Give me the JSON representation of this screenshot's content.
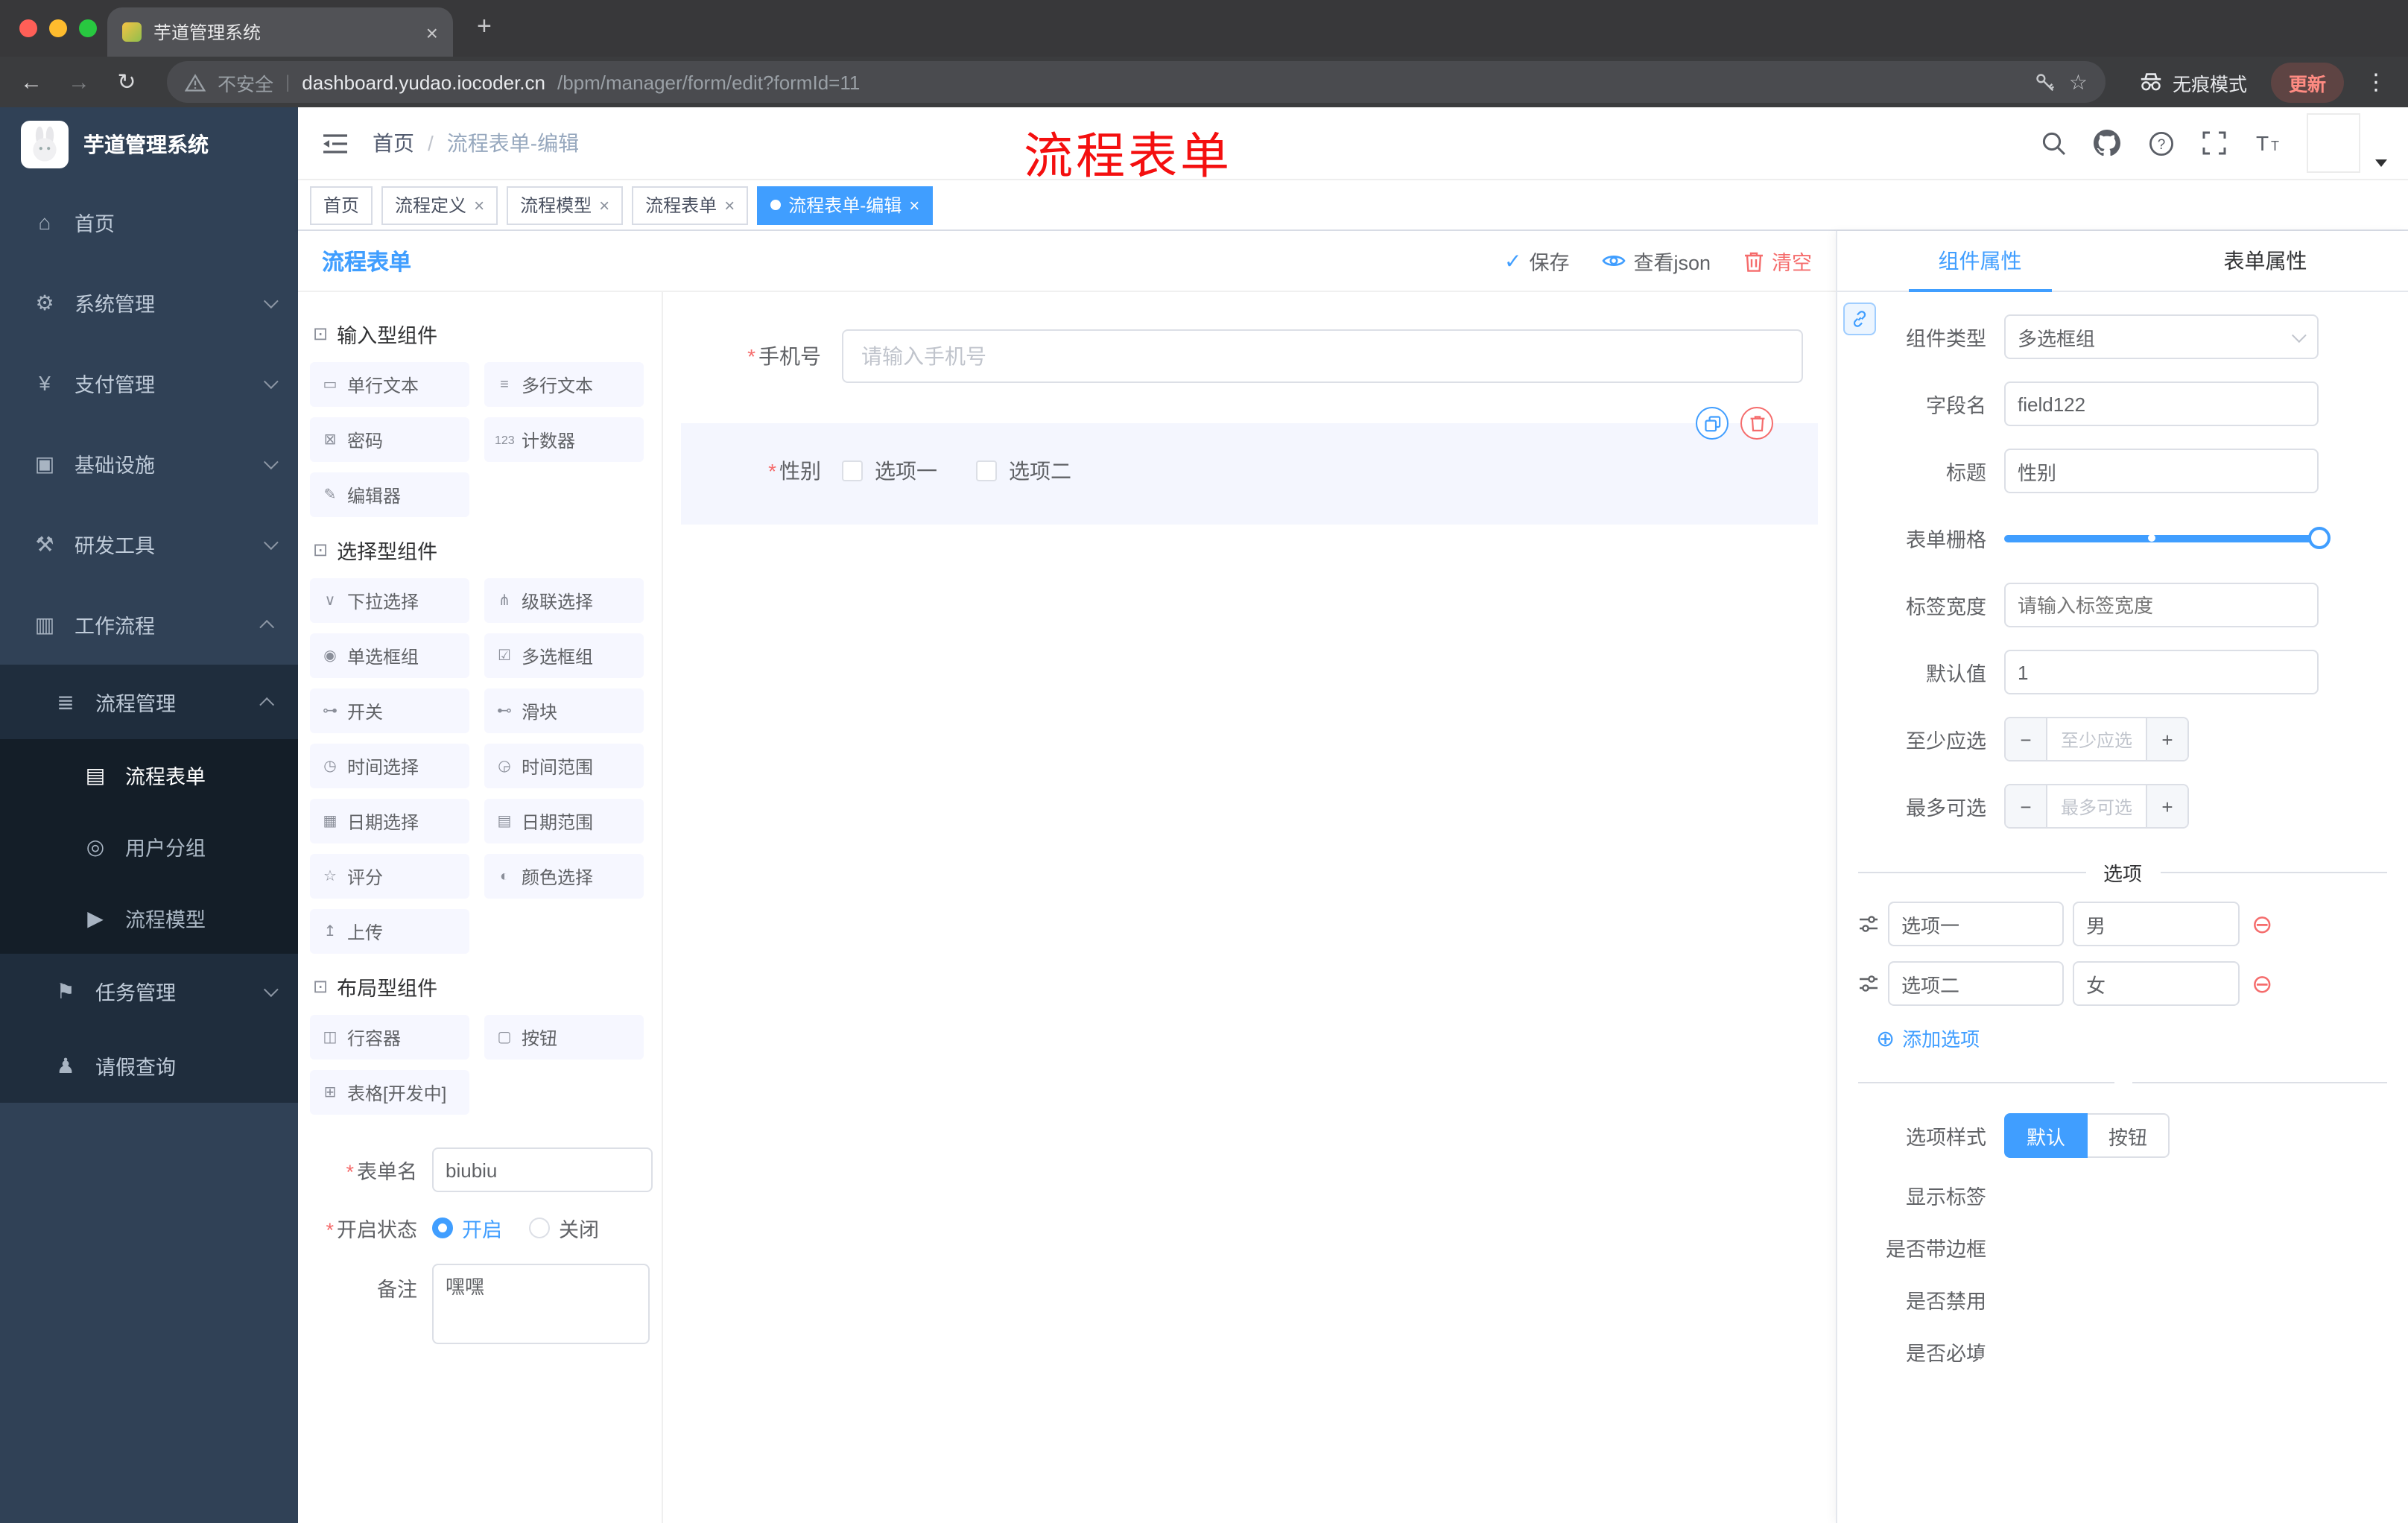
{
  "browser": {
    "tab_title": "芋道管理系统",
    "security": "不安全",
    "url_domain": "dashboard.yudao.iocoder.cn",
    "url_path": "/bpm/manager/form/edit?formId=11",
    "incognito": "无痕模式",
    "update": "更新"
  },
  "sidebar": {
    "logo": "芋道管理系统",
    "menu": [
      {
        "icon": "⌂",
        "label": "首页"
      },
      {
        "icon": "⚙",
        "label": "系统管理"
      },
      {
        "icon": "¥",
        "label": "支付管理"
      },
      {
        "icon": "▣",
        "label": "基础设施"
      },
      {
        "icon": "⚒",
        "label": "研发工具"
      },
      {
        "icon": "▥",
        "label": "工作流程"
      }
    ],
    "submenu": {
      "icon": "≣",
      "label": "流程管理"
    },
    "submenu_children": [
      {
        "icon": "▤",
        "label": "流程表单"
      },
      {
        "icon": "◎",
        "label": "用户分组"
      },
      {
        "icon": "▶",
        "label": "流程模型"
      }
    ],
    "others": [
      {
        "icon": "⚑",
        "label": "任务管理"
      },
      {
        "icon": "♟",
        "label": "请假查询"
      }
    ]
  },
  "header": {
    "breadcrumb_home": "首页",
    "breadcrumb_sep": "/",
    "breadcrumb_current": "流程表单-编辑",
    "annotation": "流程表单"
  },
  "tags": [
    {
      "label": "首页"
    },
    {
      "label": "流程定义"
    },
    {
      "label": "流程模型"
    },
    {
      "label": "流程表单"
    },
    {
      "label": "流程表单-编辑"
    }
  ],
  "designer": {
    "title": "流程表单",
    "save": "保存",
    "view_json": "查看json",
    "clear": "清空",
    "sections": [
      {
        "icon": "⊡",
        "title": "输入型组件",
        "items": [
          {
            "icon": "▭",
            "label": "单行文本"
          },
          {
            "icon": "≡",
            "label": "多行文本"
          },
          {
            "icon": "⊠",
            "label": "密码"
          },
          {
            "icon": "123",
            "label": "计数器"
          },
          {
            "icon": "✎",
            "label": "编辑器"
          }
        ]
      },
      {
        "icon": "⊡",
        "title": "选择型组件",
        "items": [
          {
            "icon": "∨",
            "label": "下拉选择"
          },
          {
            "icon": "⋔",
            "label": "级联选择"
          },
          {
            "icon": "◉",
            "label": "单选框组"
          },
          {
            "icon": "☑",
            "label": "多选框组"
          },
          {
            "icon": "⊶",
            "label": "开关"
          },
          {
            "icon": "⊷",
            "label": "滑块"
          },
          {
            "icon": "◷",
            "label": "时间选择"
          },
          {
            "icon": "◶",
            "label": "时间范围"
          },
          {
            "icon": "▦",
            "label": "日期选择"
          },
          {
            "icon": "▤",
            "label": "日期范围"
          },
          {
            "icon": "☆",
            "label": "评分"
          },
          {
            "icon": "◐",
            "label": "颜色选择"
          },
          {
            "icon": "↥",
            "label": "上传"
          }
        ]
      },
      {
        "icon": "⊡",
        "title": "布局型组件",
        "items": [
          {
            "icon": "◫",
            "label": "行容器"
          },
          {
            "icon": "▢",
            "label": "按钮"
          },
          {
            "icon": "⊞",
            "label": "表格[开发中]"
          }
        ]
      }
    ],
    "meta": {
      "name_label": "表单名",
      "name_value": "biubiu",
      "status_label": "开启状态",
      "status_on": "开启",
      "status_off": "关闭",
      "remark_label": "备注",
      "remark_value": "嘿嘿"
    },
    "canvas": {
      "phone_label": "手机号",
      "phone_placeholder": "请输入手机号",
      "gender_label": "性别",
      "gender_opt1": "选项一",
      "gender_opt2": "选项二"
    }
  },
  "panel": {
    "tab_component": "组件属性",
    "tab_form": "表单属性",
    "type_label": "组件类型",
    "type_value": "多选框组",
    "field_label": "字段名",
    "field_value": "field122",
    "title_label": "标题",
    "title_value": "性别",
    "grid_label": "表单栅格",
    "width_label": "标签宽度",
    "width_placeholder": "请输入标签宽度",
    "default_label": "默认值",
    "default_value": "1",
    "min_label": "至少应选",
    "min_placeholder": "至少应选",
    "max_label": "最多可选",
    "max_placeholder": "最多可选",
    "options_divider": "选项",
    "options": [
      {
        "name": "选项一",
        "value": "男"
      },
      {
        "name": "选项二",
        "value": "女"
      }
    ],
    "add_option": "添加选项",
    "style_label": "选项样式",
    "style_default": "默认",
    "style_button": "按钮",
    "toggle_show_label": "显示标签",
    "toggle_border": "是否带边框",
    "toggle_disabled": "是否禁用",
    "toggle_required": "是否必填"
  }
}
